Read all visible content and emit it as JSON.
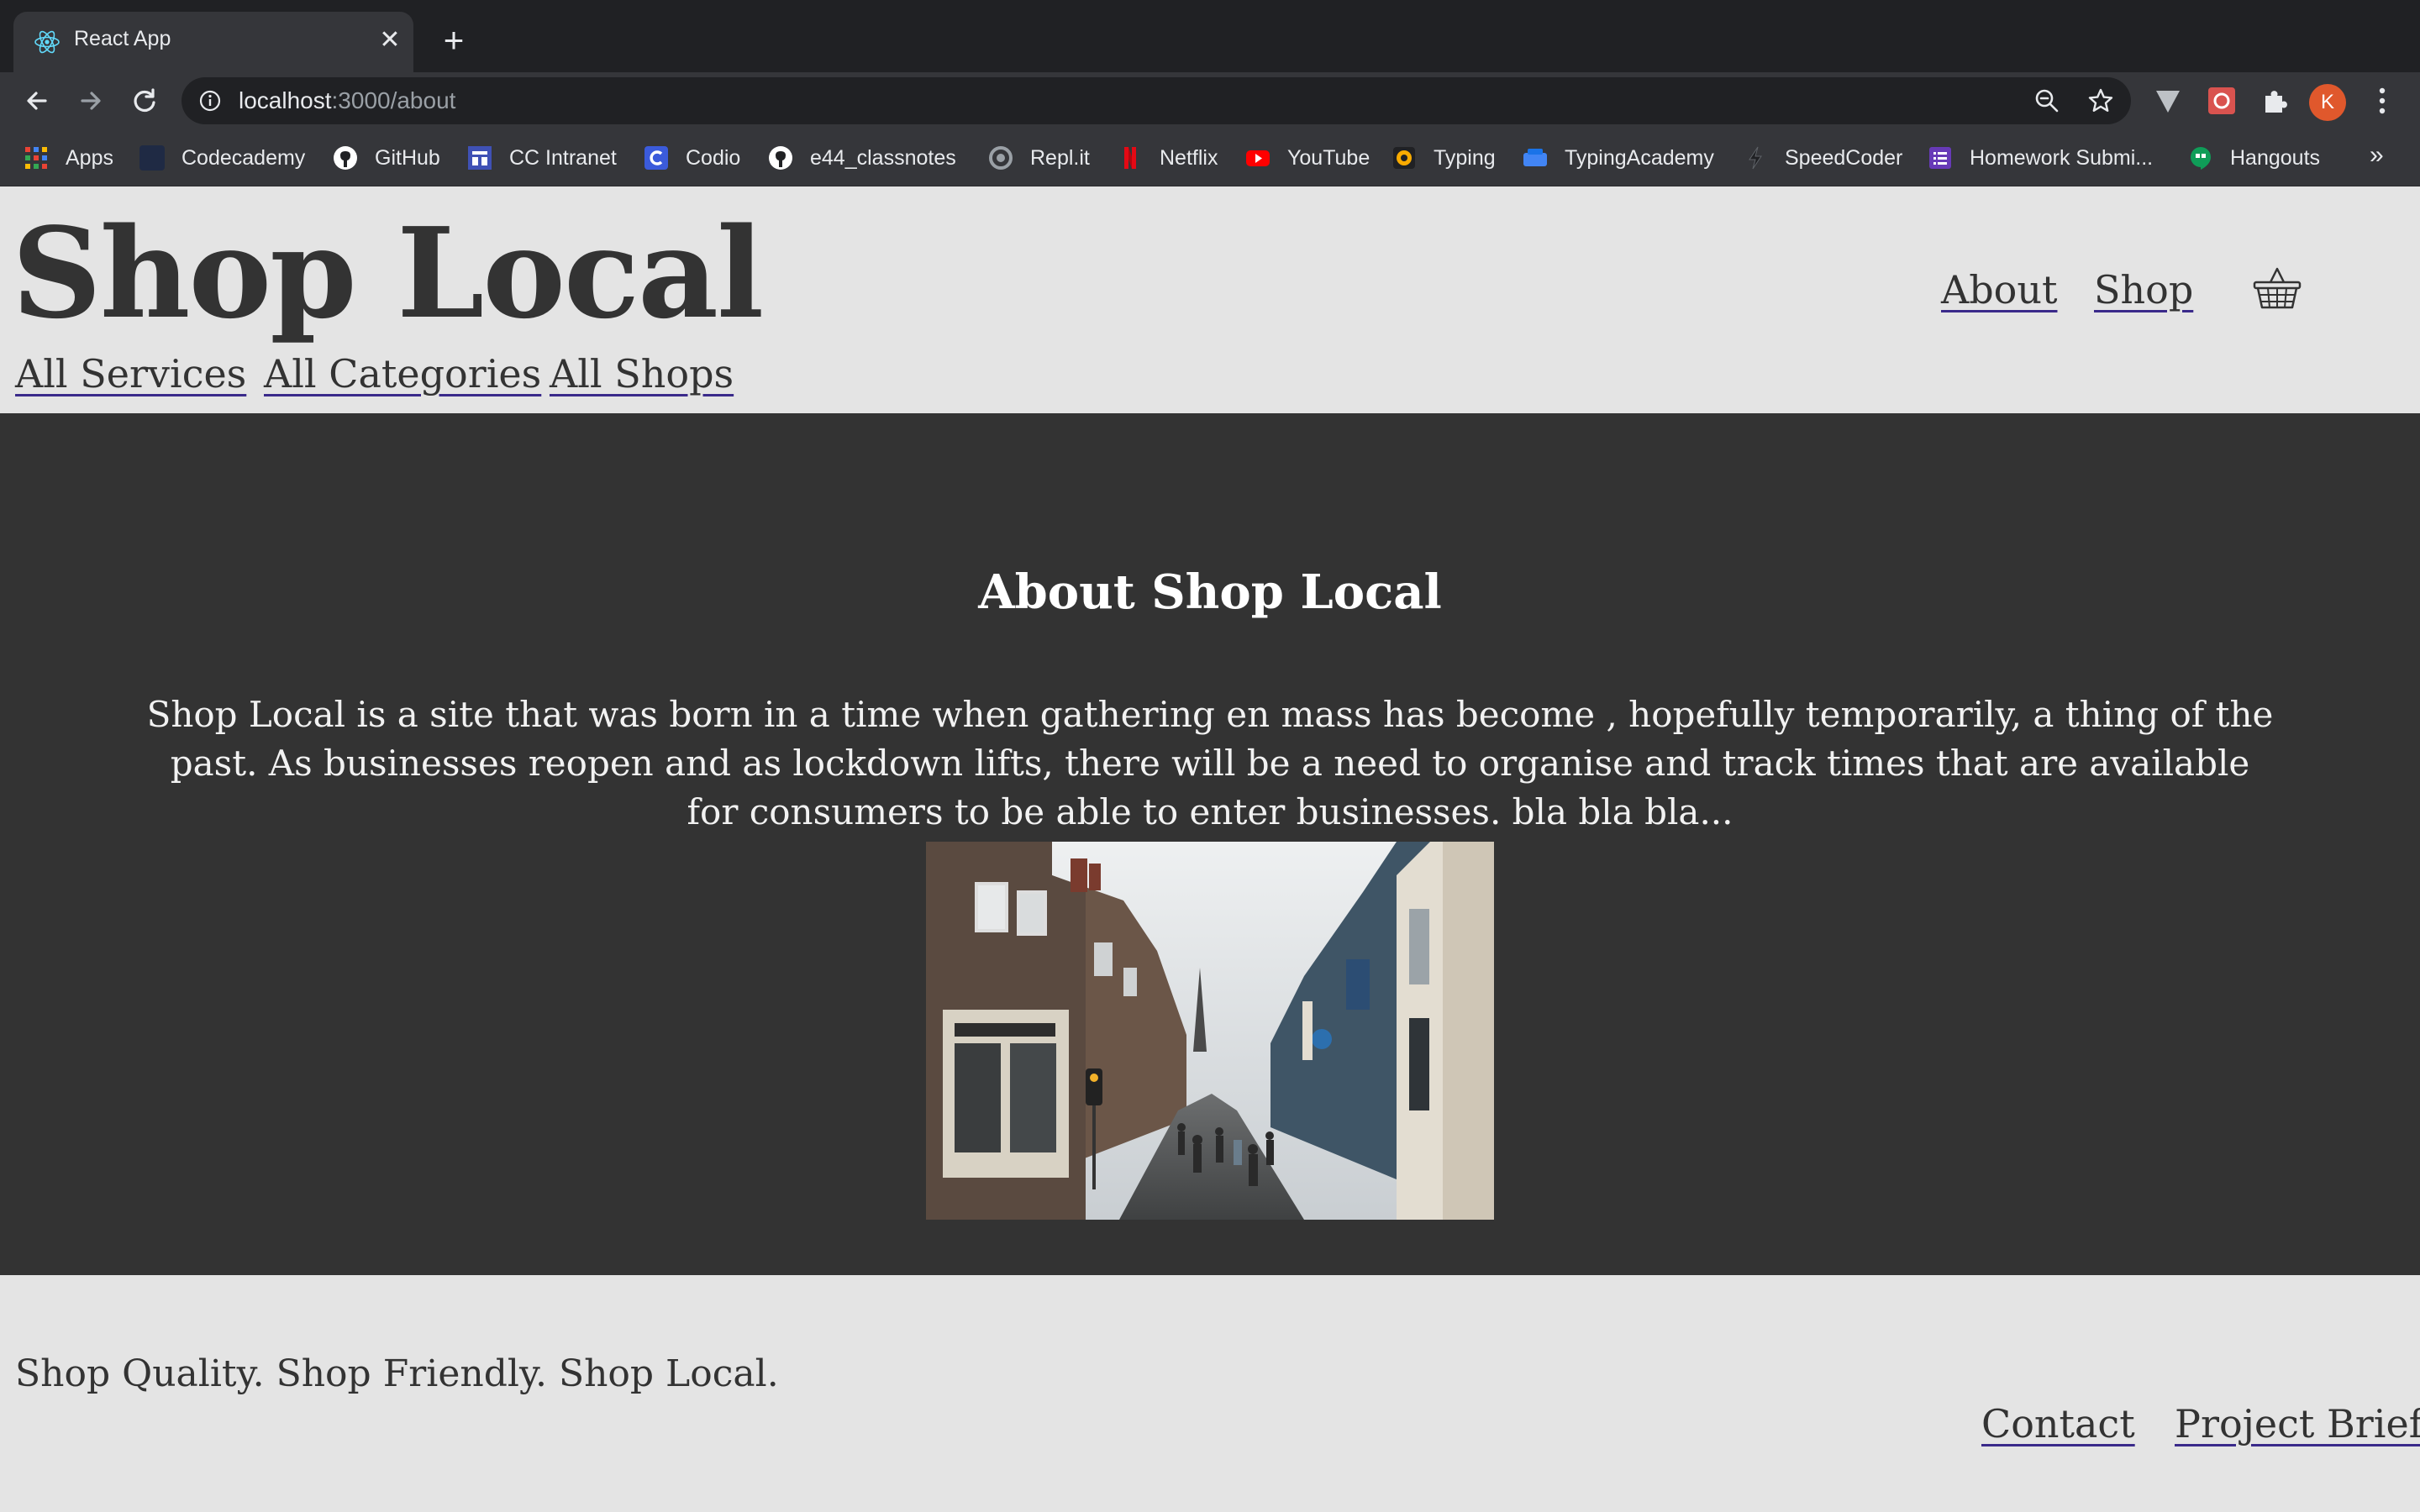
{
  "browser": {
    "tab_title": "React App",
    "tab_close": "✕",
    "new_tab": "+",
    "url_host": "localhost",
    "url_path": ":3000/about",
    "profile_initial": "K",
    "bookmarks": [
      {
        "label": "Apps",
        "icon": "apps-grid-icon",
        "color": "#ea4335"
      },
      {
        "label": "Codecademy",
        "icon": "codecademy-icon",
        "color": "#1f2a44"
      },
      {
        "label": "GitHub",
        "icon": "github-icon",
        "color": "#ffffff"
      },
      {
        "label": "CC Intranet",
        "icon": "cc-intranet-icon",
        "color": "#3f51b5"
      },
      {
        "label": "Codio",
        "icon": "codio-icon",
        "color": "#3b5bdb"
      },
      {
        "label": "e44_classnotes",
        "icon": "github-icon",
        "color": "#ffffff"
      },
      {
        "label": "Repl.it",
        "icon": "replit-icon",
        "color": "#9aa0a6"
      },
      {
        "label": "Netflix",
        "icon": "netflix-icon",
        "color": "#e50914"
      },
      {
        "label": "YouTube",
        "icon": "youtube-icon",
        "color": "#ff0000"
      },
      {
        "label": "Typing",
        "icon": "typing-icon",
        "color": "#f9ab00"
      },
      {
        "label": "TypingAcademy",
        "icon": "typingacademy-icon",
        "color": "#4285f4"
      },
      {
        "label": "SpeedCoder",
        "icon": "speedcoder-icon",
        "color": "#202124"
      },
      {
        "label": "Homework Submi...",
        "icon": "form-icon",
        "color": "#673ab7"
      },
      {
        "label": "Hangouts",
        "icon": "hangouts-icon",
        "color": "#0f9d58"
      }
    ],
    "bookmarks_more": "»"
  },
  "site": {
    "brand": "Shop Local",
    "main_nav": {
      "about": "About",
      "shop": "Shop"
    },
    "sub_nav": {
      "services": "All Services",
      "categories": "All Categories",
      "shops": "All Shops"
    },
    "about": {
      "title": "About Shop Local",
      "body": "Shop Local is a site that was born in a time when gathering en mass has become , hopefully temporarily, a thing of the past. As businesses reopen and as lockdown lifts, there will be a need to organise and track times that are available for consumers to be able to enter businesses. bla bla bla..."
    },
    "footer": {
      "tagline": "Shop Quality. Shop Friendly. Shop Local.",
      "contact": "Contact",
      "project_brief": "Project Brief"
    }
  },
  "colors": {
    "header_bg": "#e4e4e4",
    "section_bg": "#333333",
    "text_dark": "#333333",
    "link_underline": "#3a2a8a"
  }
}
